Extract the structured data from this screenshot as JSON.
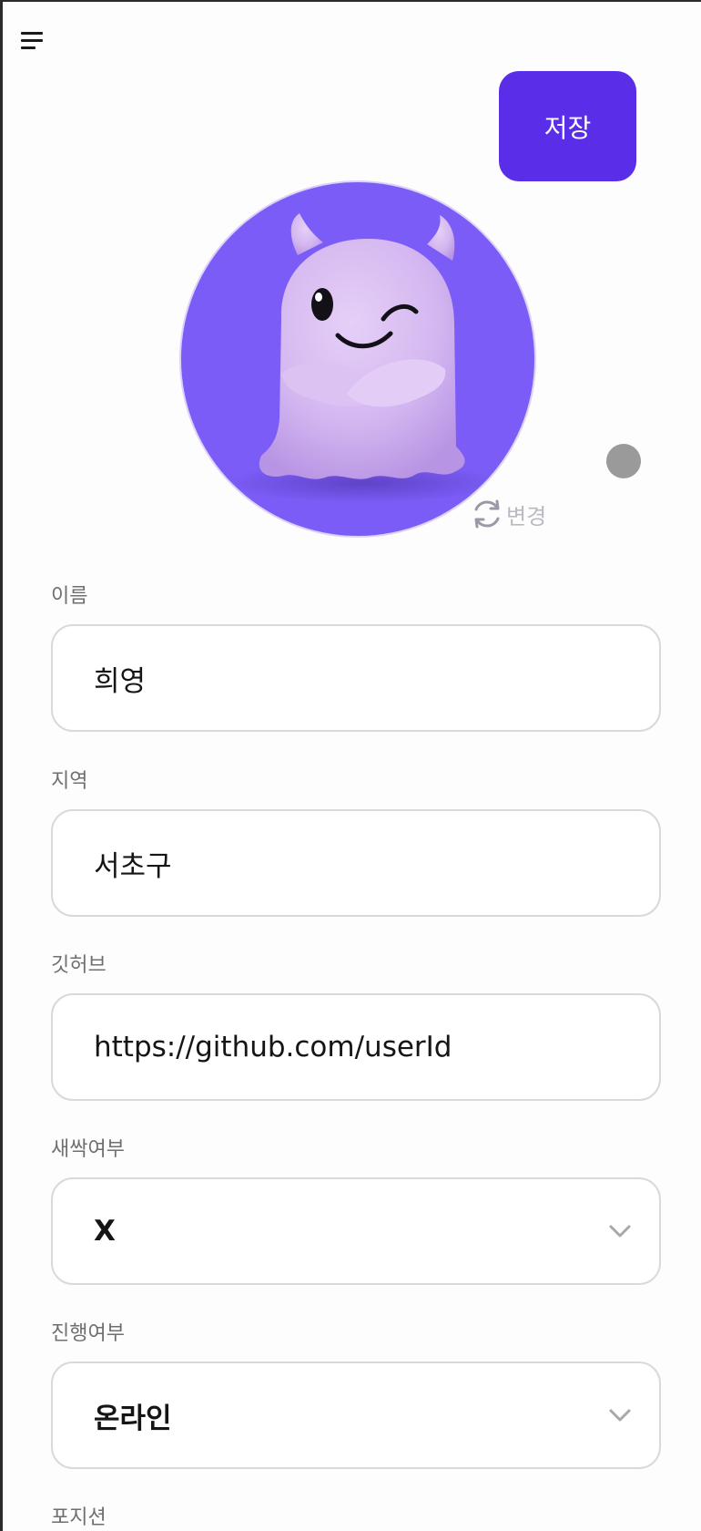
{
  "header": {
    "menu_icon": "hamburger-menu-icon",
    "save_label": "저장"
  },
  "profile": {
    "avatar_alt": "",
    "change_label": "변경",
    "change_icon": "refresh-icon",
    "status_color": "#9a9a9a"
  },
  "form": {
    "name": {
      "label": "이름",
      "value": "희영"
    },
    "region": {
      "label": "지역",
      "value": "서초구"
    },
    "github": {
      "label": "깃허브",
      "value": "https://github.com/userId"
    },
    "newbie": {
      "label": "새싹여부",
      "value": "X",
      "icon": "chevron-down-icon"
    },
    "progress": {
      "label": "진행여부",
      "value": "온라인",
      "icon": "chevron-down-icon"
    },
    "position": {
      "label": "포지션"
    }
  },
  "colors": {
    "accent": "#5a2ee8",
    "avatar_bg": "#7b5cf6"
  }
}
